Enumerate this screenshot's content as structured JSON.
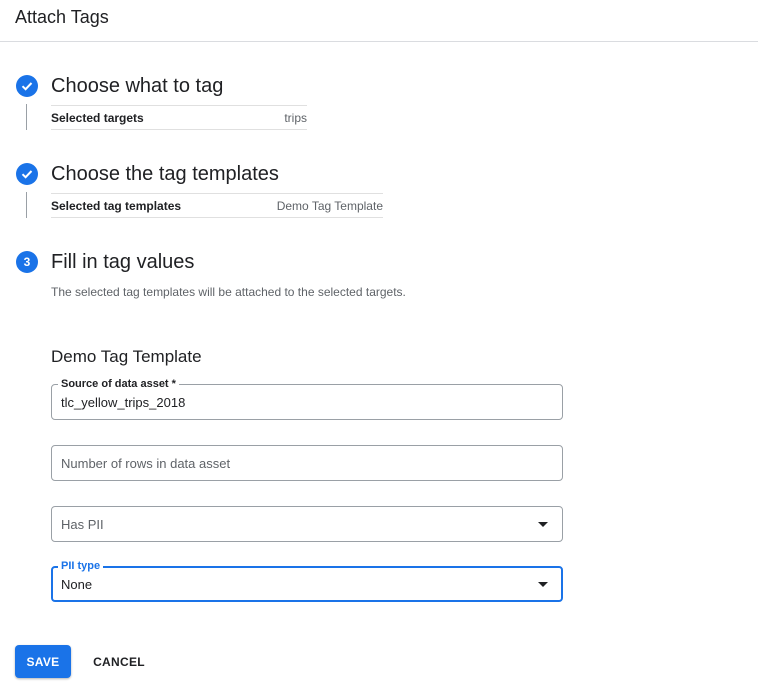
{
  "header": {
    "title": "Attach Tags"
  },
  "steps": [
    {
      "title": "Choose what to tag",
      "status": "completed",
      "summary_label": "Selected targets",
      "summary_value": "trips"
    },
    {
      "title": "Choose the tag templates",
      "status": "completed",
      "summary_label": "Selected tag templates",
      "summary_value": "Demo Tag Template"
    },
    {
      "number": "3",
      "title": "Fill in tag values",
      "status": "active",
      "description": "The selected tag templates will be attached to the selected targets."
    }
  ],
  "template": {
    "title": "Demo Tag Template",
    "fields": {
      "source": {
        "label": "Source of data asset *",
        "value": "tlc_yellow_trips_2018"
      },
      "rows": {
        "placeholder": "Number of rows in data asset"
      },
      "has_pii": {
        "placeholder": "Has PII"
      },
      "pii_type": {
        "label": "PII type",
        "value": "None"
      }
    }
  },
  "actions": {
    "save_label": "SAVE",
    "cancel_label": "CANCEL"
  },
  "colors": {
    "accent": "#1a73e8",
    "text": "#202124",
    "muted": "#5f6368",
    "border": "#9aa0a6"
  }
}
